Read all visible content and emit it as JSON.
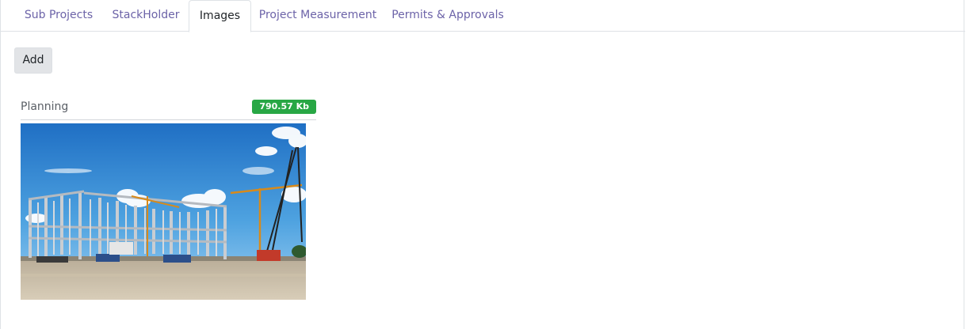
{
  "tabs": [
    {
      "label": "Sub Projects",
      "active": false
    },
    {
      "label": "StackHolder",
      "active": false
    },
    {
      "label": "Images",
      "active": true
    },
    {
      "label": "Project Measurement",
      "active": false
    },
    {
      "label": "Permits & Approvals",
      "active": false
    }
  ],
  "toolbar": {
    "add_label": "Add"
  },
  "images": [
    {
      "title": "Planning",
      "size": "790.57 Kb",
      "thumbnail": "construction site with cranes and steel frame"
    }
  ],
  "colors": {
    "tab_link": "#6c63a8",
    "badge": "#28a745",
    "button_bg": "#e2e4e7"
  }
}
